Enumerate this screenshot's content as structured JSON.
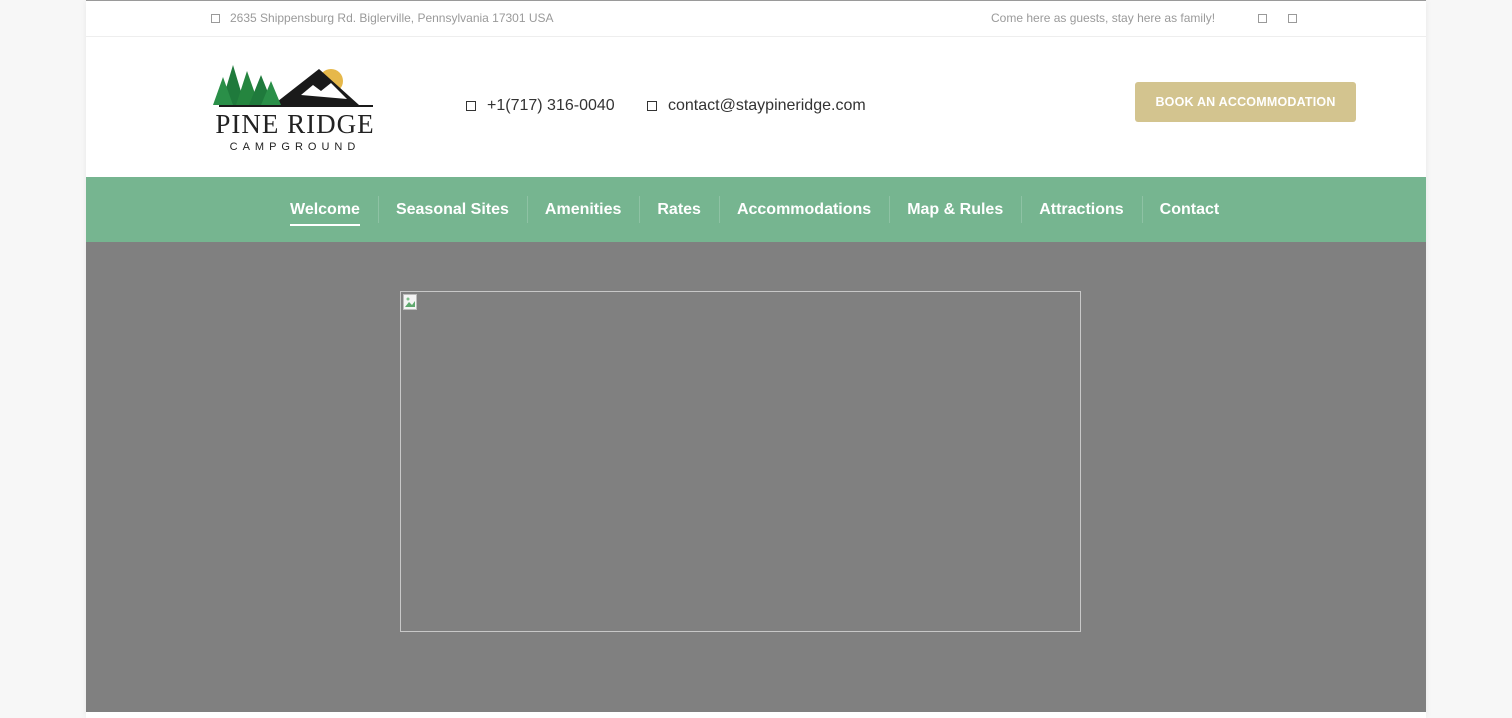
{
  "topbar": {
    "address": "2635 Shippensburg Rd. Biglerville, Pennsylvania 17301 USA",
    "tagline": "Come here as guests, stay here as family!",
    "address_icon": "square-icon",
    "social_icons": [
      "square-icon",
      "square-icon"
    ]
  },
  "header": {
    "logo": {
      "brand": "PINE RIDGE",
      "sub": "CAMPGROUND"
    },
    "phone": "+1(717) 316-0040",
    "email": "contact@staypineridge.com",
    "book_button": "BOOK AN ACCOMMODATION"
  },
  "nav": {
    "items": [
      {
        "label": "Welcome",
        "active": true
      },
      {
        "label": "Seasonal Sites"
      },
      {
        "label": "Amenities"
      },
      {
        "label": "Rates"
      },
      {
        "label": "Accommodations"
      },
      {
        "label": "Map & Rules"
      },
      {
        "label": "Attractions"
      },
      {
        "label": "Contact"
      }
    ]
  },
  "colors": {
    "nav_bg": "#76b590",
    "button_bg": "#d3c48f",
    "hero_bg": "#808080",
    "logo_green": "#1f7a3c",
    "logo_sun": "#e6b84a"
  }
}
